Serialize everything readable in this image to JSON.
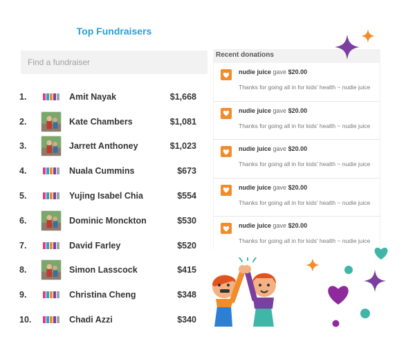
{
  "header": {
    "title": "Top Fundraisers"
  },
  "search": {
    "placeholder": "Find a fundraiser",
    "value": ""
  },
  "fundraisers": [
    {
      "rank": "1.",
      "name": "Amit Nayak",
      "amount": "$1,668",
      "avatar": "logo"
    },
    {
      "rank": "2.",
      "name": "Kate Chambers",
      "amount": "$1,081",
      "avatar": "photo"
    },
    {
      "rank": "3.",
      "name": "Jarrett Anthoney",
      "amount": "$1,023",
      "avatar": "photo"
    },
    {
      "rank": "4.",
      "name": "Nuala Cummins",
      "amount": "$673",
      "avatar": "logo"
    },
    {
      "rank": "5.",
      "name": "Yujing Isabel Chia",
      "amount": "$554",
      "avatar": "logo"
    },
    {
      "rank": "6.",
      "name": "Dominic Monckton",
      "amount": "$530",
      "avatar": "photo"
    },
    {
      "rank": "7.",
      "name": "David Farley",
      "amount": "$520",
      "avatar": "logo"
    },
    {
      "rank": "8.",
      "name": "Simon Lasscock",
      "amount": "$415",
      "avatar": "photo"
    },
    {
      "rank": "9.",
      "name": "Christina Cheng",
      "amount": "$348",
      "avatar": "logo"
    },
    {
      "rank": "10.",
      "name": "Chadi Azzi",
      "amount": "$340",
      "avatar": "logo"
    }
  ],
  "donations": {
    "title": "Recent donations",
    "items": [
      {
        "donor": "nudie juice",
        "verb": "gave",
        "amount": "$20.00",
        "message": "Thanks for going all in for kids' health ~ nudie juice"
      },
      {
        "donor": "nudie juice",
        "verb": "gave",
        "amount": "$20.00",
        "message": "Thanks for going all in for kids' health ~ nudie juice"
      },
      {
        "donor": "nudie juice",
        "verb": "gave",
        "amount": "$20.00",
        "message": "Thanks for going all in for kids' health ~ nudie juice"
      },
      {
        "donor": "nudie juice",
        "verb": "gave",
        "amount": "$20.00",
        "message": "Thanks for going all in for kids' health ~ nudie juice"
      },
      {
        "donor": "nudie juice",
        "verb": "gave",
        "amount": "$20.00",
        "message": "Thanks for going all in for kids' health ~ nudie juice"
      }
    ]
  },
  "colors": {
    "title_blue": "#2a9fd6",
    "heart_orange": "#f28b2a",
    "sparkle_purple": "#7b3fa0",
    "sparkle_orange": "#f28b2a",
    "dot_teal": "#3fb6a8",
    "heart_purple": "#8e2a9c"
  },
  "icons": {
    "donation_badge": "heart-icon",
    "avatar_logo": "charity-logo-icon",
    "decor": [
      "sparkle-icon",
      "heart-icon",
      "dot-icon",
      "high-five-illustration"
    ]
  }
}
